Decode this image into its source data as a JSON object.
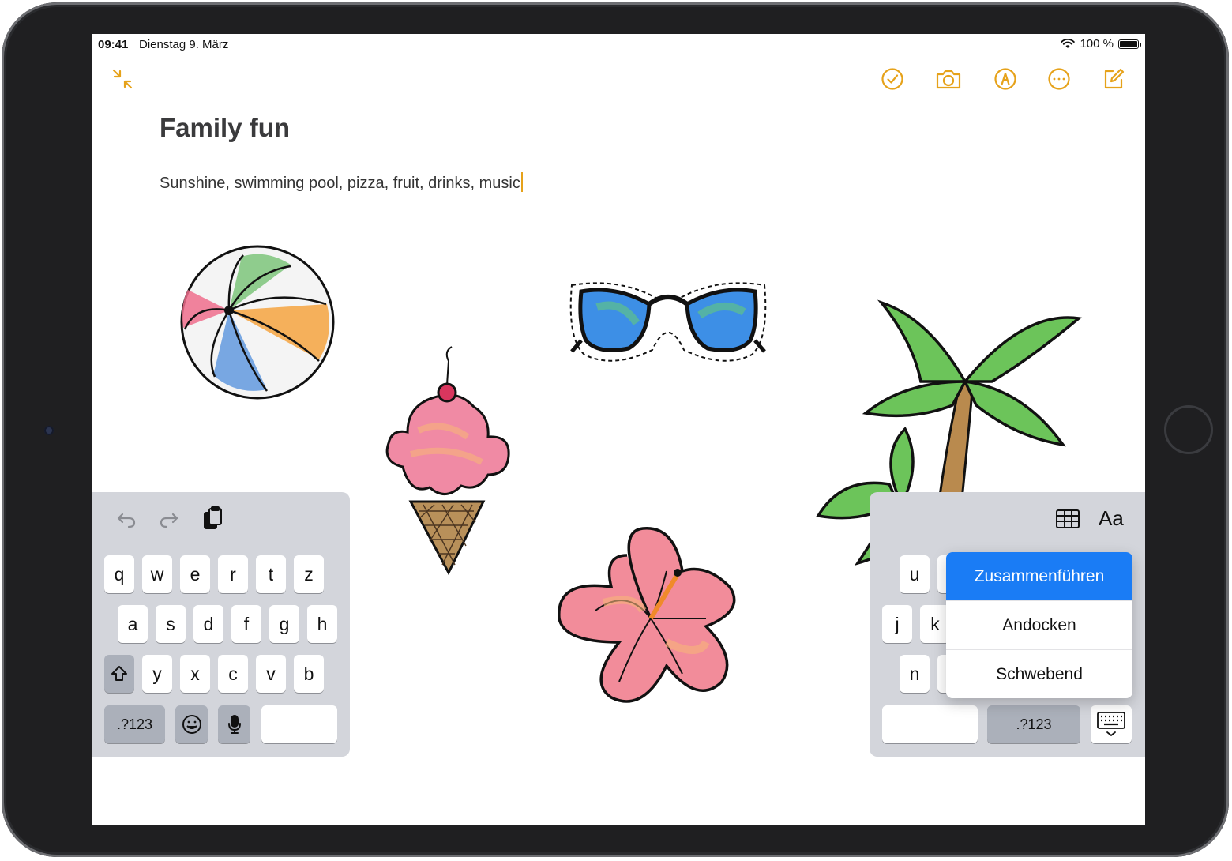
{
  "status_bar": {
    "time": "09:41",
    "date": "Dienstag 9. März",
    "battery": "100 %"
  },
  "toolbar": {
    "icons": [
      "collapse-icon",
      "checklist-icon",
      "camera-icon",
      "markup-icon",
      "more-icon",
      "compose-icon"
    ],
    "accent_color": "#e6a21a"
  },
  "note": {
    "title": "Family fun",
    "body": "Sunshine, swimming pool, pizza, fruit, drinks, music"
  },
  "stickers": [
    "beach-ball",
    "ice-cream",
    "sunglasses",
    "hibiscus-flower",
    "palm-tree"
  ],
  "keyboard_left": {
    "row1": [
      "q",
      "w",
      "e",
      "r",
      "t",
      "z"
    ],
    "row2": [
      "a",
      "s",
      "d",
      "f",
      "g",
      "h"
    ],
    "row3": [
      "y",
      "x",
      "c",
      "v",
      "b"
    ],
    "numbers_key": ".?123"
  },
  "keyboard_right": {
    "format_label": "Aa",
    "row1": [
      "u"
    ],
    "row2": [
      "j",
      "k"
    ],
    "row3": [
      "n"
    ],
    "numbers_key": ".?123"
  },
  "keyboard_menu": {
    "items": [
      {
        "label": "Zusammenführen",
        "selected": true
      },
      {
        "label": "Andocken",
        "selected": false
      },
      {
        "label": "Schwebend",
        "selected": false
      }
    ]
  }
}
